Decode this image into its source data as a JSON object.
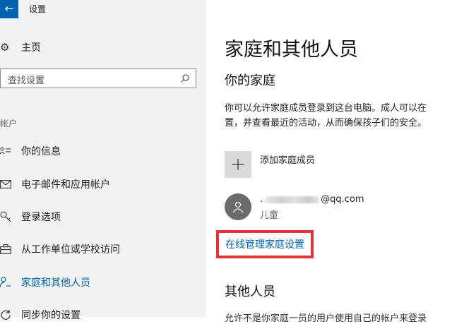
{
  "window": {
    "title": "设置",
    "back_icon": "back-arrow-icon",
    "accent": "#0063b1"
  },
  "sidebar": {
    "home": {
      "label": "主页",
      "icon": "gear-icon"
    },
    "search": {
      "placeholder": "查找设置",
      "icon": "search-icon"
    },
    "section_label": "帐户",
    "items": [
      {
        "label": "你的信息",
        "icon": "person-card-icon",
        "active": false
      },
      {
        "label": "电子邮件和应用帐户",
        "icon": "mail-icon",
        "active": false
      },
      {
        "label": "登录选项",
        "icon": "key-icon",
        "active": false
      },
      {
        "label": "从工作单位或学校访问",
        "icon": "briefcase-icon",
        "active": false
      },
      {
        "label": "家庭和其他人员",
        "icon": "add-person-icon",
        "active": true
      },
      {
        "label": "同步你的设置",
        "icon": "sync-icon",
        "active": false
      }
    ]
  },
  "main": {
    "title": "家庭和其他人员",
    "family_heading": "你的家庭",
    "family_desc_line1": "你可以允许家庭成员登录到这台电脑。成人可以在",
    "family_desc_line2": "置，并查看最近的活动，从而确保孩子们的安全。",
    "add_member_label": "添加家庭成员",
    "member": {
      "email_prefix": ".",
      "email_suffix": "@qq.com",
      "role": "儿童"
    },
    "manage_link": "在线管理家庭设置",
    "highlight_color": "#e2323b",
    "others_heading": "其他人员",
    "others_desc": "允许不是你家庭一员的用户使用自己的帐户来登录"
  }
}
